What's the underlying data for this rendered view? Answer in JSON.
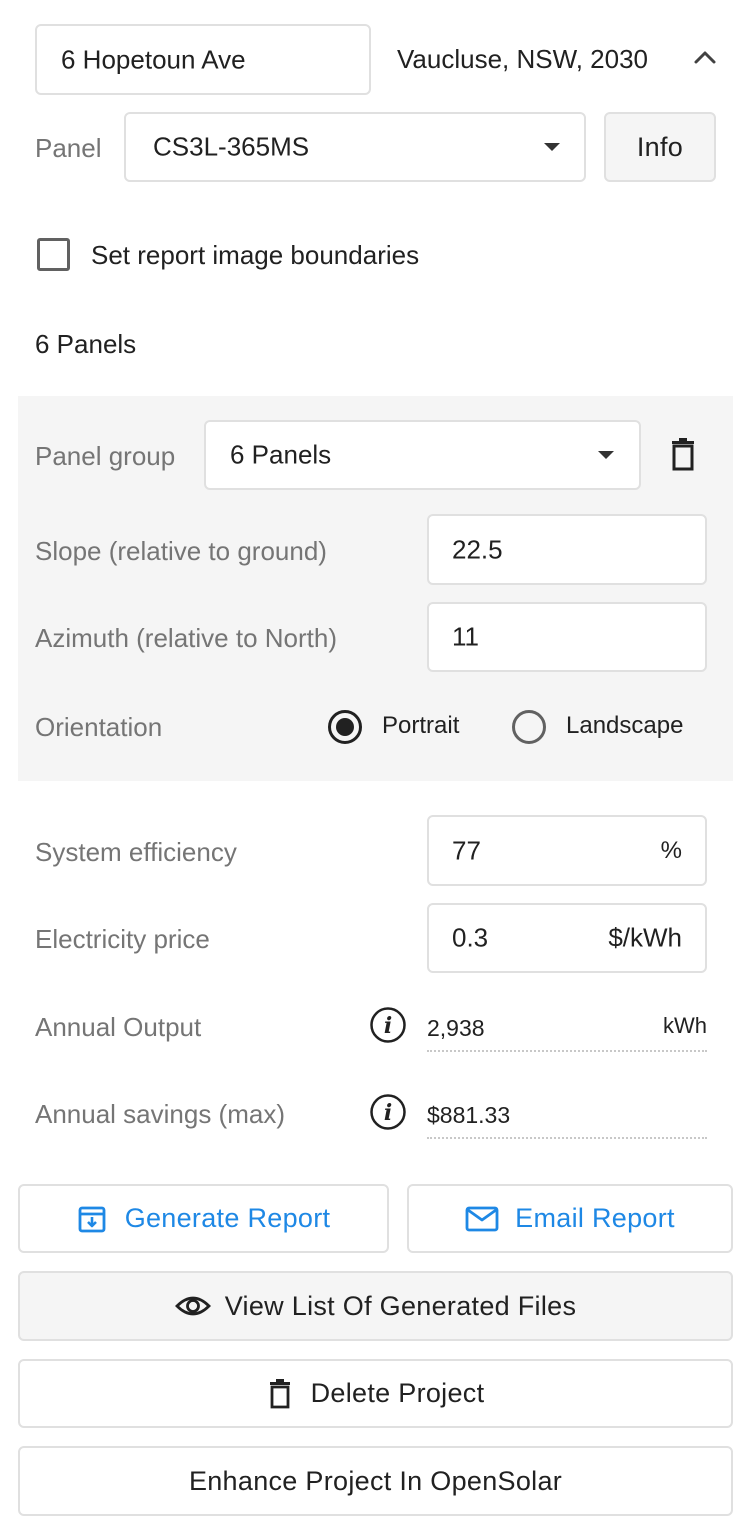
{
  "address": {
    "street": "6 Hopetoun Ave",
    "locality": "Vaucluse, NSW, 2030"
  },
  "panel": {
    "label": "Panel",
    "selected": "CS3L-365MS",
    "info_button": "Info"
  },
  "report_boundaries": {
    "label": "Set report image boundaries",
    "checked": false
  },
  "panels_heading": "6 Panels",
  "panel_group": {
    "label": "Panel group",
    "selected": "6 Panels",
    "slope_label": "Slope (relative to ground)",
    "slope_value": "22.5",
    "azimuth_label": "Azimuth (relative to North)",
    "azimuth_value": "11",
    "orientation_label": "Orientation",
    "orientation_options": [
      "Portrait",
      "Landscape"
    ],
    "orientation_selected": "Portrait"
  },
  "system": {
    "efficiency_label": "System efficiency",
    "efficiency_value": "77",
    "efficiency_unit": "%",
    "price_label": "Electricity price",
    "price_value": "0.3",
    "price_unit": "$/kWh",
    "output_label": "Annual Output",
    "output_value": "2,938",
    "output_unit": "kWh",
    "savings_label": "Annual savings (max)",
    "savings_value": "$881.33"
  },
  "actions": {
    "generate_report": "Generate Report",
    "email_report": "Email Report",
    "view_files": "View List Of Generated Files",
    "delete_project": "Delete Project",
    "enhance_project": "Enhance Project In OpenSolar"
  },
  "colors": {
    "accent": "#1e88e5",
    "panel_group_bg": "#f5f5f5",
    "label_grey": "#757575"
  }
}
